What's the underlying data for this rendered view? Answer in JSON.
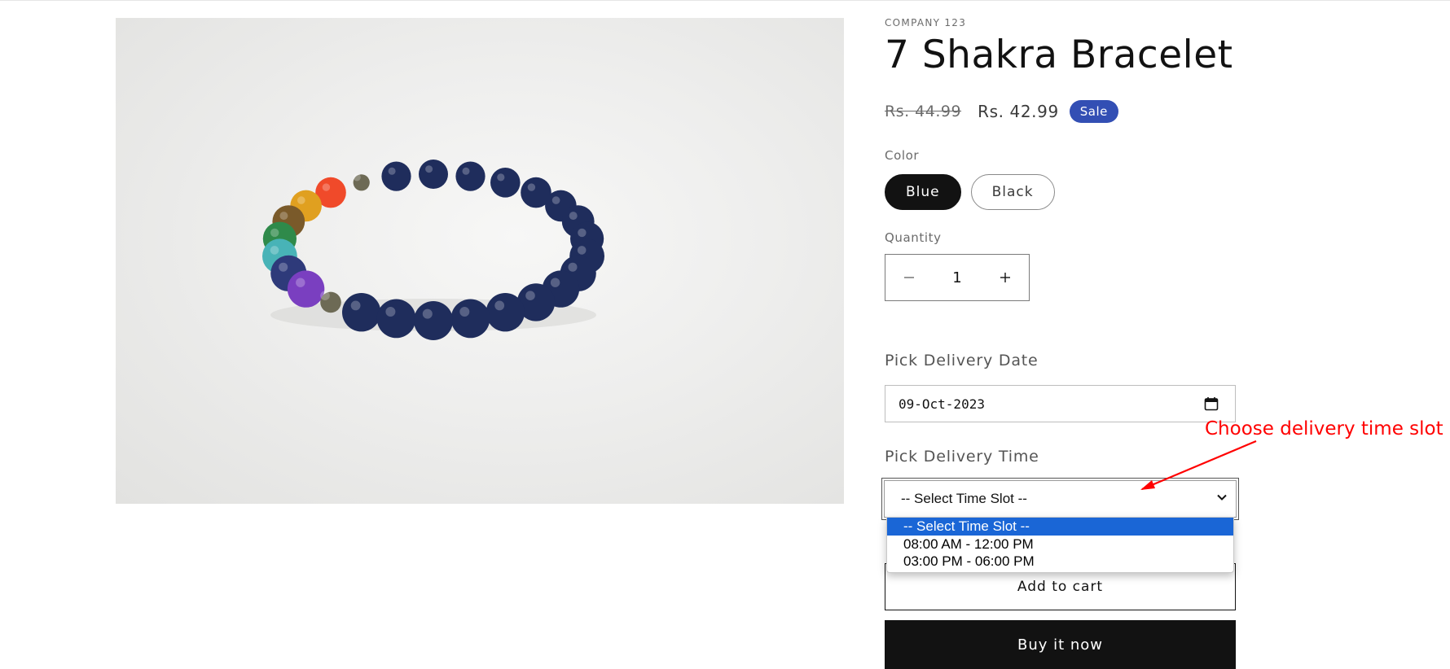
{
  "product": {
    "vendor": "COMPANY 123",
    "title": "7 Shakra Bracelet",
    "price_compare": "Rs. 44.99",
    "price_sale": "Rs. 42.99",
    "badge": "Sale",
    "image_subject": "bracelet-image"
  },
  "color": {
    "label": "Color",
    "options": [
      "Blue",
      "Black"
    ],
    "selected": "Blue"
  },
  "quantity": {
    "label": "Quantity",
    "value": "1",
    "minus": "−",
    "plus": "+"
  },
  "delivery": {
    "date_label": "Pick Delivery Date",
    "date_value": "09-Oct-2023",
    "time_label": "Pick Delivery Time",
    "time_selected": "-- Select Time Slot --",
    "time_options": [
      "-- Select Time Slot --",
      "08:00 AM - 12:00 PM",
      "03:00 PM - 06:00 PM"
    ]
  },
  "actions": {
    "add_to_cart": "Add to cart",
    "buy_now": "Buy it now"
  },
  "annotation": {
    "text": "Choose delivery time slot",
    "color": "#ff0000"
  },
  "colors": {
    "sale_badge": "#334fb4",
    "selected_option": "#1a66d6",
    "primary_button": "#121212"
  }
}
